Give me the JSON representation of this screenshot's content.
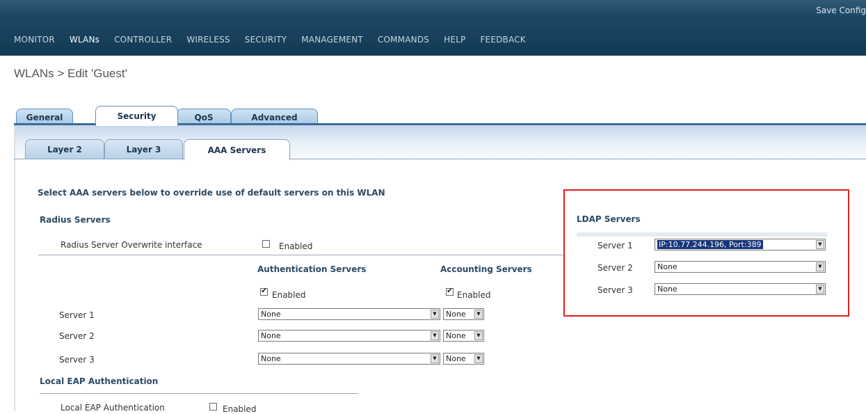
{
  "topbar": {
    "save_label": "Save Config",
    "menu": [
      "MONITOR",
      "WLANs",
      "CONTROLLER",
      "WIRELESS",
      "SECURITY",
      "MANAGEMENT",
      "COMMANDS",
      "HELP",
      "FEEDBACK"
    ]
  },
  "breadcrumb": "WLANs > Edit  'Guest'",
  "tabs": [
    "General",
    "Security",
    "QoS",
    "Advanced"
  ],
  "subtabs": [
    "Layer 2",
    "Layer 3",
    "AAA Servers"
  ],
  "intro": "Select AAA servers below to override use of default servers on this WLAN",
  "radius": {
    "heading": "Radius Servers",
    "overwrite_label": "Radius Server Overwrite interface",
    "overwrite_enabled_label": "Enabled",
    "auth_heading": "Authentication Servers",
    "acct_heading": "Accounting Servers",
    "auth_enabled_label": "Enabled",
    "acct_enabled_label": "Enabled",
    "rows": [
      {
        "label": "Server 1",
        "auth": "None",
        "acct": "None"
      },
      {
        "label": "Server 2",
        "auth": "None",
        "acct": "None"
      },
      {
        "label": "Server 3",
        "auth": "None",
        "acct": "None"
      }
    ]
  },
  "ldap": {
    "heading": "LDAP Servers",
    "rows": [
      {
        "label": "Server 1",
        "value": "IP:10.77.244.196, Port:389"
      },
      {
        "label": "Server 2",
        "value": "None"
      },
      {
        "label": "Server 3",
        "value": "None"
      }
    ]
  },
  "local_eap": {
    "heading": "Local EAP Authentication",
    "label": "Local EAP Authentication",
    "enabled_label": "Enabled"
  },
  "colors": {
    "topbar": "#1d4763",
    "tab_active": "#ffffff",
    "highlight_box": "#e02020"
  }
}
